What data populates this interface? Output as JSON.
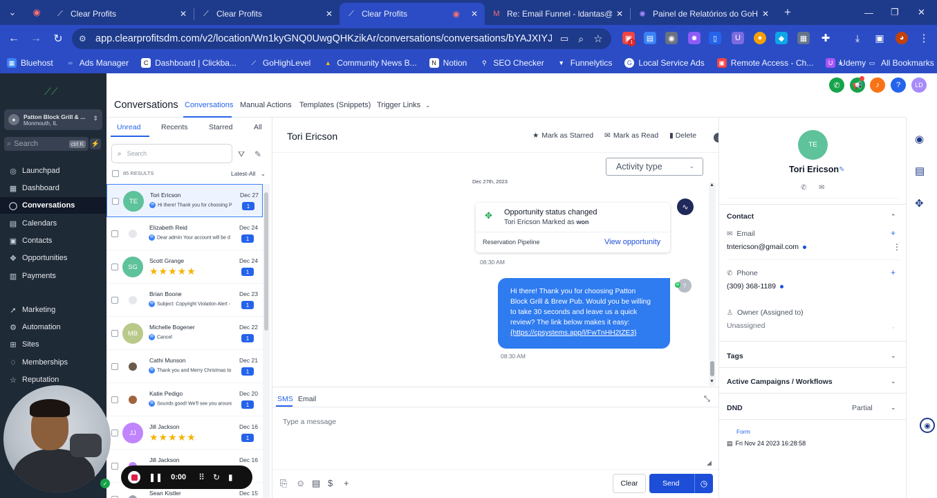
{
  "browser": {
    "tabs": [
      {
        "title": "Clear Profits",
        "active": false
      },
      {
        "title": "Clear Profits",
        "active": false
      },
      {
        "title": "Clear Profits",
        "active": true
      },
      {
        "title": "Re: Email Funnel - ldantas@clea",
        "active": false
      },
      {
        "title": "Painel de Relatórios do GoHighL",
        "active": false
      }
    ],
    "url": "app.clearprofitsdm.com/v2/location/Wn1kyGNQ0UwgQHKzikAr/conversations/conversations/bYAJXIYJWKQSZggAMzjw",
    "extension_badge": "1",
    "bookmarks": [
      "Bluehost",
      "Ads Manager",
      "Dashboard | Clickba...",
      "GoHighLevel",
      "Community News B...",
      "Notion",
      "SEO Checker",
      "Funnelytics",
      "Local Service Ads",
      "Remote Access - Ch...",
      "Udemy"
    ],
    "all_bookmarks": "All Bookmarks"
  },
  "sidebar": {
    "account_name": "Patton Block Grill & ...",
    "account_location": "Monmouth, IL",
    "search_placeholder": "Search",
    "search_shortcut": "ctrl K",
    "items": [
      {
        "label": "Launchpad",
        "icon": "launchpad-icon",
        "glyph": "◎"
      },
      {
        "label": "Dashboard",
        "icon": "dashboard-icon",
        "glyph": "▦"
      },
      {
        "label": "Conversations",
        "icon": "chat-icon",
        "glyph": "◯"
      },
      {
        "label": "Calendars",
        "icon": "calendar-icon",
        "glyph": "▤"
      },
      {
        "label": "Contacts",
        "icon": "contacts-icon",
        "glyph": "▣"
      },
      {
        "label": "Opportunities",
        "icon": "opportunities-icon",
        "glyph": "✥"
      },
      {
        "label": "Payments",
        "icon": "payments-icon",
        "glyph": "▥"
      },
      {
        "label": "Marketing",
        "icon": "marketing-icon",
        "glyph": "➚"
      },
      {
        "label": "Automation",
        "icon": "automation-icon",
        "glyph": "⚙"
      },
      {
        "label": "Sites",
        "icon": "sites-icon",
        "glyph": "⊞"
      },
      {
        "label": "Memberships",
        "icon": "memberships-icon",
        "glyph": "♢"
      },
      {
        "label": "Reputation",
        "icon": "reputation-icon",
        "glyph": "☆"
      }
    ]
  },
  "header": {
    "title": "Conversations",
    "tabs": [
      "Conversations",
      "Manual Actions",
      "Templates (Snippets)",
      "Trigger Links"
    ],
    "avatar_initials": "LD"
  },
  "list": {
    "filter_tabs": [
      "Unread",
      "Recents",
      "Starred",
      "All"
    ],
    "search_placeholder": "Search",
    "results": "85 RESULTS",
    "sort": "Latest-All",
    "rows": [
      {
        "name": "Tori Ericson",
        "initials": "TE",
        "snippet": "Hi there! Thank you for choosing P",
        "date": "Dec 27",
        "badge": "1",
        "color": "#5ec29a",
        "stars": "",
        "selected": true
      },
      {
        "name": "Elizabeth Reid",
        "initials": "",
        "snippet": "Dear admin Your account will be d",
        "date": "Dec 24",
        "badge": "1",
        "color": "#e5e7eb",
        "stars": "",
        "selected": false
      },
      {
        "name": "Scott Grange",
        "initials": "SG",
        "snippet": "",
        "date": "Dec 24",
        "badge": "1",
        "color": "#5ec29a",
        "stars": "★★★★★",
        "selected": false
      },
      {
        "name": "Brian Boone",
        "initials": "",
        "snippet": "Subject: Copyright Violation Alert -",
        "date": "Dec 23",
        "badge": "1",
        "color": "#e5e7eb",
        "stars": "",
        "selected": false
      },
      {
        "name": "Michelle Bogener",
        "initials": "MB",
        "snippet": "Cancel",
        "date": "Dec 22",
        "badge": "1",
        "color": "#b9c98a",
        "stars": "",
        "selected": false
      },
      {
        "name": "Cathi Munson",
        "initials": "",
        "snippet": "Thank you and Merry Christmas to",
        "date": "Dec 21",
        "badge": "1",
        "color": "#6b5a4a",
        "stars": "",
        "selected": false
      },
      {
        "name": "Katie Pedigo",
        "initials": "",
        "snippet": "Sounds good! We'll see you around",
        "date": "Dec 20",
        "badge": "1",
        "color": "#a0643e",
        "stars": "",
        "selected": false
      },
      {
        "name": "Jill Jackson",
        "initials": "JJ",
        "snippet": "",
        "date": "Dec 16",
        "badge": "1",
        "color": "#c084fc",
        "stars": "★★★★★",
        "selected": false
      },
      {
        "name": "Jill Jackson",
        "initials": "",
        "snippet": "",
        "date": "Dec 16",
        "badge": "",
        "color": "#c084fc",
        "stars": "",
        "selected": false
      },
      {
        "name": "Sean Kistler",
        "initials": "",
        "snippet": "",
        "date": "Dec 15",
        "badge": "",
        "color": "#9ca3af",
        "stars": "",
        "selected": false
      }
    ]
  },
  "chat": {
    "contact_name": "Tori Ericson",
    "actions": {
      "star": "Mark as Starred",
      "read": "Mark as Read",
      "delete": "Delete"
    },
    "activity_type": "Activity type",
    "date_separator": "Dec 27th, 2023",
    "opportunity": {
      "title": "Opportunity status changed",
      "subtitle_prefix": "Tori Ericson Marked as",
      "status": "won",
      "pipeline": "Reservation Pipeline",
      "link": "View opportunity"
    },
    "time_1": "08:30 AM",
    "message_lines": [
      "Hi there! Thank you for choosing Patton",
      "Block Grill & Brew Pub. Would you be willing",
      "to take 30 seconds and leave us a quick",
      "review? The link below makes it easy:"
    ],
    "message_link": "{https://cpsystems.app/l/FwTnHH2tZE3}",
    "message_avatar": "?",
    "time_2": "08:30 AM",
    "composer_tabs": [
      "SMS",
      "Email"
    ],
    "message_placeholder": "Type a message",
    "clear_label": "Clear",
    "send_label": "Send"
  },
  "details": {
    "initials": "TE",
    "name": "Tori Ericson",
    "contact_section": "Contact",
    "email_label": "Email",
    "email_value": "tntericson@gmail.com",
    "phone_label": "Phone",
    "phone_value": "(309) 368-1189",
    "owner_label": "Owner (Assigned to)",
    "owner_value": "Unassigned",
    "tags": "Tags",
    "campaigns": "Active Campaigns / Workflows",
    "dnd": "DND",
    "dnd_value": "Partial",
    "form_label": "Form",
    "form_date": "Fri Nov 24 2023 16:28:58"
  },
  "recorder": {
    "time": "0:00"
  }
}
